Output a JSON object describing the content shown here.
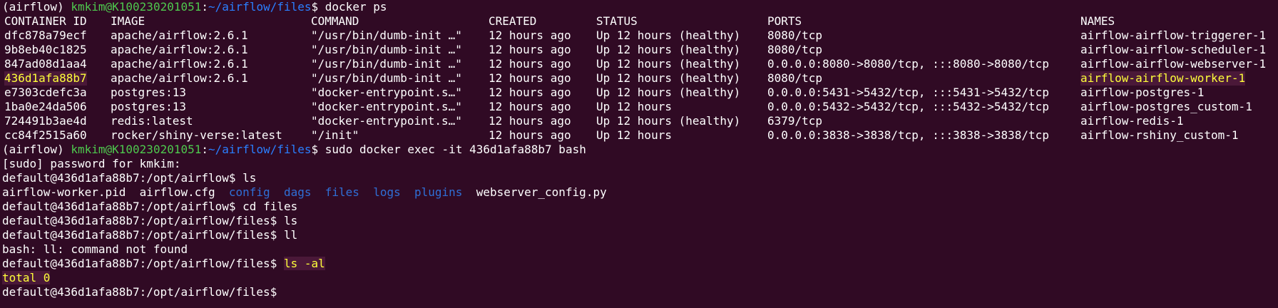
{
  "prompt": {
    "venv": "(airflow)",
    "user_host": "kmkim@K100230201051",
    "sep": ":",
    "path_files": "~/airflow/files",
    "dollar": "$"
  },
  "container_prompt": {
    "user_host": "default@436d1afa88b7",
    "path": ":/opt/airflow",
    "path_files": ":/opt/airflow/files",
    "dollar": "$"
  },
  "commands": {
    "docker_ps": " docker ps",
    "exec": " sudo docker exec -it 436d1afa88b7 bash",
    "ls": " ls",
    "cd_files": " cd files",
    "ll": " ll",
    "ls_al": "ls -al"
  },
  "output": {
    "sudo_password": "[sudo] password for kmkim:",
    "ls_files": [
      "airflow-worker.pid",
      "airflow.cfg"
    ],
    "ls_dirs": [
      "config",
      "dags",
      "files",
      "logs",
      "plugins"
    ],
    "ls_files2": [
      "webserver_config.py"
    ],
    "ll_error": "bash: ll: command not found",
    "total": "total 0"
  },
  "docker_table": {
    "headers": {
      "id": "CONTAINER ID",
      "image": "IMAGE",
      "command": "COMMAND",
      "created": "CREATED",
      "status": "STATUS",
      "ports": "PORTS",
      "names": "NAMES"
    },
    "rows": [
      {
        "id": "dfc878a79ecf",
        "image": "apache/airflow:2.6.1",
        "command": "\"/usr/bin/dumb-init …\"",
        "created": "12 hours ago",
        "status": "Up 12 hours (healthy)",
        "ports": "8080/tcp",
        "names": "airflow-airflow-triggerer-1"
      },
      {
        "id": "9b8eb40c1825",
        "image": "apache/airflow:2.6.1",
        "command": "\"/usr/bin/dumb-init …\"",
        "created": "12 hours ago",
        "status": "Up 12 hours (healthy)",
        "ports": "8080/tcp",
        "names": "airflow-airflow-scheduler-1"
      },
      {
        "id": "847ad08d1aa4",
        "image": "apache/airflow:2.6.1",
        "command": "\"/usr/bin/dumb-init …\"",
        "created": "12 hours ago",
        "status": "Up 12 hours (healthy)",
        "ports": "0.0.0.0:8080->8080/tcp, :::8080->8080/tcp",
        "names": "airflow-airflow-webserver-1"
      },
      {
        "id": "436d1afa88b7",
        "image": "apache/airflow:2.6.1",
        "command": "\"/usr/bin/dumb-init …\"",
        "created": "12 hours ago",
        "status": "Up 12 hours (healthy)",
        "ports": "8080/tcp",
        "names": "airflow-airflow-worker-1"
      },
      {
        "id": "e7303cdefc3a",
        "image": "postgres:13",
        "command": "\"docker-entrypoint.s…\"",
        "created": "12 hours ago",
        "status": "Up 12 hours (healthy)",
        "ports": "0.0.0.0:5431->5432/tcp, :::5431->5432/tcp",
        "names": "airflow-postgres-1"
      },
      {
        "id": "1ba0e24da506",
        "image": "postgres:13",
        "command": "\"docker-entrypoint.s…\"",
        "created": "12 hours ago",
        "status": "Up 12 hours",
        "ports": "0.0.0.0:5432->5432/tcp, :::5432->5432/tcp",
        "names": "airflow-postgres_custom-1"
      },
      {
        "id": "724491b3ae4d",
        "image": "redis:latest",
        "command": "\"docker-entrypoint.s…\"",
        "created": "12 hours ago",
        "status": "Up 12 hours (healthy)",
        "ports": "6379/tcp",
        "names": "airflow-redis-1"
      },
      {
        "id": "cc84f2515a60",
        "image": "rocker/shiny-verse:latest",
        "command": "\"/init\"",
        "created": "12 hours ago",
        "status": "Up 12 hours",
        "ports": "0.0.0.0:3838->3838/tcp, :::3838->3838/tcp",
        "names": "airflow-rshiny_custom-1"
      }
    ]
  },
  "colors": {
    "background": "#300a24",
    "text": "#ffffff",
    "prompt_user": "#4ec94e",
    "prompt_path": "#2a7fff",
    "directory": "#2f6fd6",
    "highlight_text": "#ffff3a",
    "highlight_bg": "#4a1838"
  }
}
